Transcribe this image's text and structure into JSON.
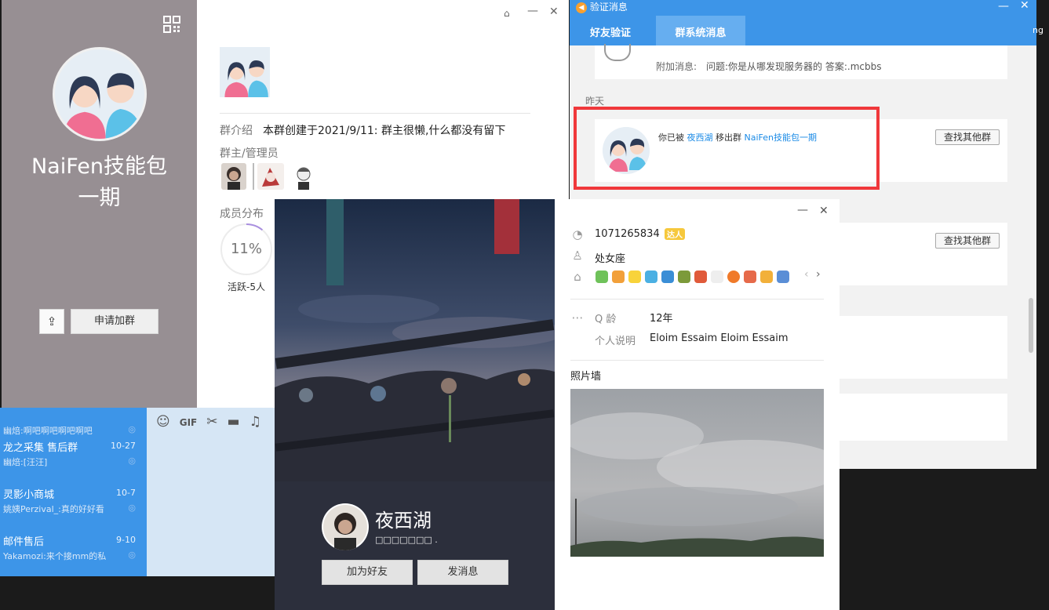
{
  "bg_chat": {
    "items": [
      {
        "name": "",
        "date": "",
        "msg": "幽焙:啊吧啊吧啊吧啊吧"
      },
      {
        "name": "龙之采集 售后群",
        "date": "10-27",
        "msg": "幽焙:[汪汪]"
      },
      {
        "name": "灵影小商城",
        "date": "10-7",
        "msg": "姚姨Perzival_:真的好好看"
      },
      {
        "name": "邮件售后",
        "date": "9-10",
        "msg": "Yakamozi:来个接mm的私"
      }
    ],
    "toolbar": [
      "☺",
      "GIF",
      "✂",
      "▬",
      "♫"
    ]
  },
  "verify": {
    "title": "验证消息",
    "tabs": [
      "好友验证",
      "群系统消息"
    ],
    "top_card": {
      "extra_label": "附加消息:",
      "extra_text": "问题:你是从哪发现服务器的 答案:.mcbbs"
    },
    "section_label": "昨天",
    "notice": {
      "prefix": "你已被",
      "user": "夜西湖",
      "middle": "移出群",
      "group": "NaiFen技能包一期",
      "button": "查找其他群"
    },
    "second_button": "查找其他群",
    "highlight_color": "#f0383b",
    "edge_text": "ng"
  },
  "group": {
    "name": "NaiFen技能包一期",
    "intro_label": "群介绍",
    "intro_text": "本群创建于2021/9/11: 群主很懒,什么都没有留下",
    "admin_label": "群主/管理员",
    "dist_label": "成员分布",
    "active_percent": "11%",
    "active_fraction": 0.11,
    "active_label": "活跃-5人",
    "apply_button": "申请加群"
  },
  "card": {
    "name": "夜西湖",
    "subtitle": "□□□□□□□ .",
    "add_friend": "加为好友",
    "send_msg": "发消息",
    "qq": "1071265834",
    "vip_badge": "达人",
    "constellation": "处女座",
    "qage_label": "Q 龄",
    "qage": "12年",
    "bio_label": "个人说明",
    "bio": "Eloim Essaim Eloim Essaim",
    "wall_label": "照片墙"
  }
}
